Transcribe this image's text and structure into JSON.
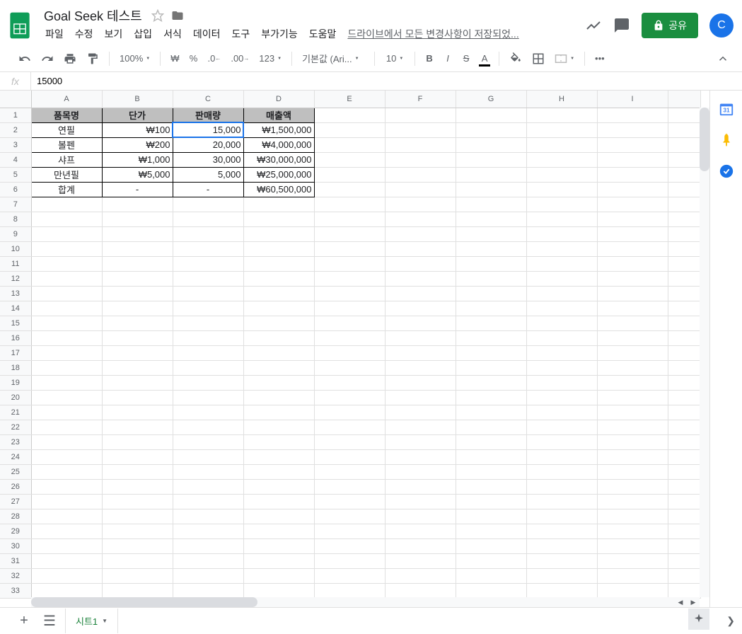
{
  "doc": {
    "title": "Goal Seek 테스트",
    "save_status": "드라이브에서 모든 변경사항이 저장되었..."
  },
  "menu": {
    "file": "파일",
    "edit": "수정",
    "view": "보기",
    "insert": "삽입",
    "format": "서식",
    "data": "데이터",
    "tools": "도구",
    "addons": "부가기능",
    "help": "도움말"
  },
  "share": {
    "label": "공유"
  },
  "avatar": {
    "letter": "C"
  },
  "toolbar": {
    "zoom": "100%",
    "currency": "₩",
    "percent": "%",
    "dec_less": ".0",
    "dec_more": ".00_",
    "numfmt": "123",
    "font": "기본값 (Ari...",
    "size": "10",
    "bold": "B",
    "italic": "I",
    "strike": "S",
    "textcolor": "A"
  },
  "formula": {
    "value": "15000"
  },
  "columns": [
    "A",
    "B",
    "C",
    "D",
    "E",
    "F",
    "G",
    "H",
    "I",
    ""
  ],
  "headers": {
    "A": "품목명",
    "B": "단가",
    "C": "판매량",
    "D": "매출액"
  },
  "rows": [
    {
      "A": "연필",
      "B": "₩100",
      "C": "15,000",
      "D": "₩1,500,000"
    },
    {
      "A": "볼펜",
      "B": "₩200",
      "C": "20,000",
      "D": "₩4,000,000"
    },
    {
      "A": "샤프",
      "B": "₩1,000",
      "C": "30,000",
      "D": "₩30,000,000"
    },
    {
      "A": "만년필",
      "B": "₩5,000",
      "C": "5,000",
      "D": "₩25,000,000"
    },
    {
      "A": "합계",
      "B": "-",
      "C": "-",
      "D": "₩60,500,000"
    }
  ],
  "active_cell": "C2",
  "sheet": {
    "name": "시트1"
  },
  "side_icons": {
    "calendar": "31"
  }
}
